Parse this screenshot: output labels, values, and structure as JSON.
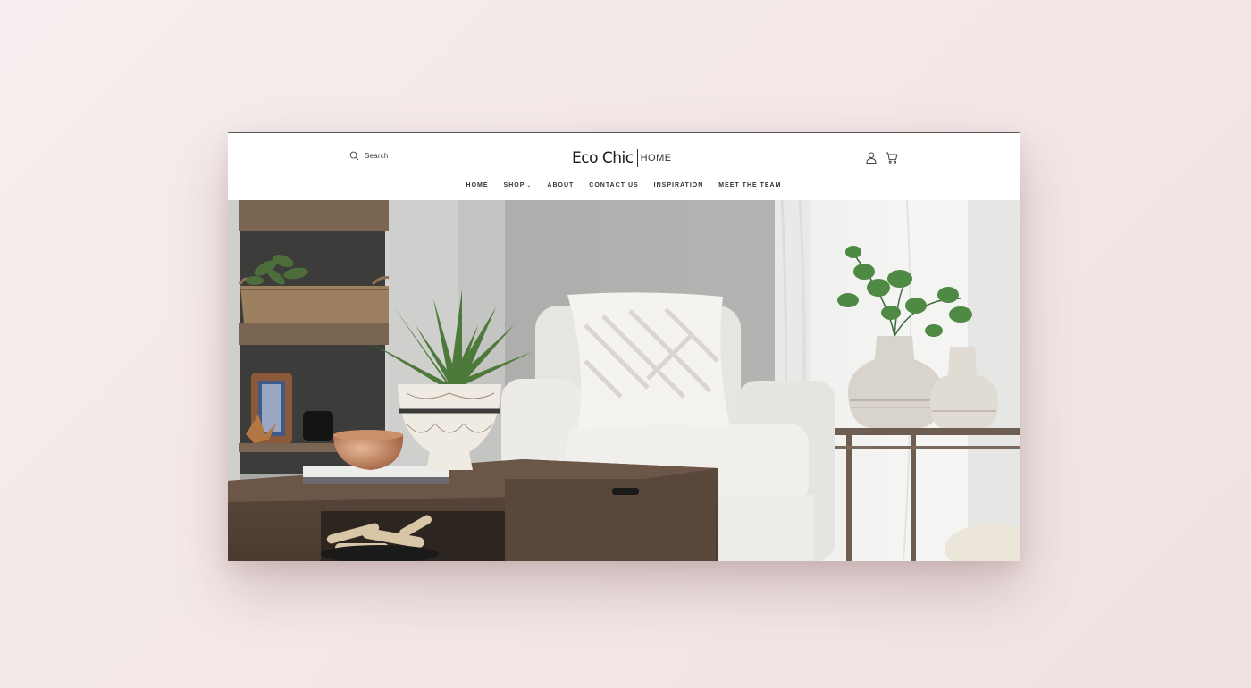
{
  "header": {
    "search_label": "Search",
    "logo_main": "Eco Chic",
    "logo_sub": "HOME"
  },
  "nav": {
    "items": [
      {
        "label": "HOME"
      },
      {
        "label": "SHOP"
      },
      {
        "label": "ABOUT"
      },
      {
        "label": "CONTACT US"
      },
      {
        "label": "INSPIRATION"
      },
      {
        "label": "MEET THE TEAM"
      }
    ]
  },
  "icons": {
    "search": "search-icon",
    "account": "user-icon",
    "cart": "cart-icon",
    "shop_dropdown": "chevron-down-icon"
  },
  "colors": {
    "page_background": "#f4e8e8",
    "header_background": "#ffffff",
    "text": "#333333"
  }
}
